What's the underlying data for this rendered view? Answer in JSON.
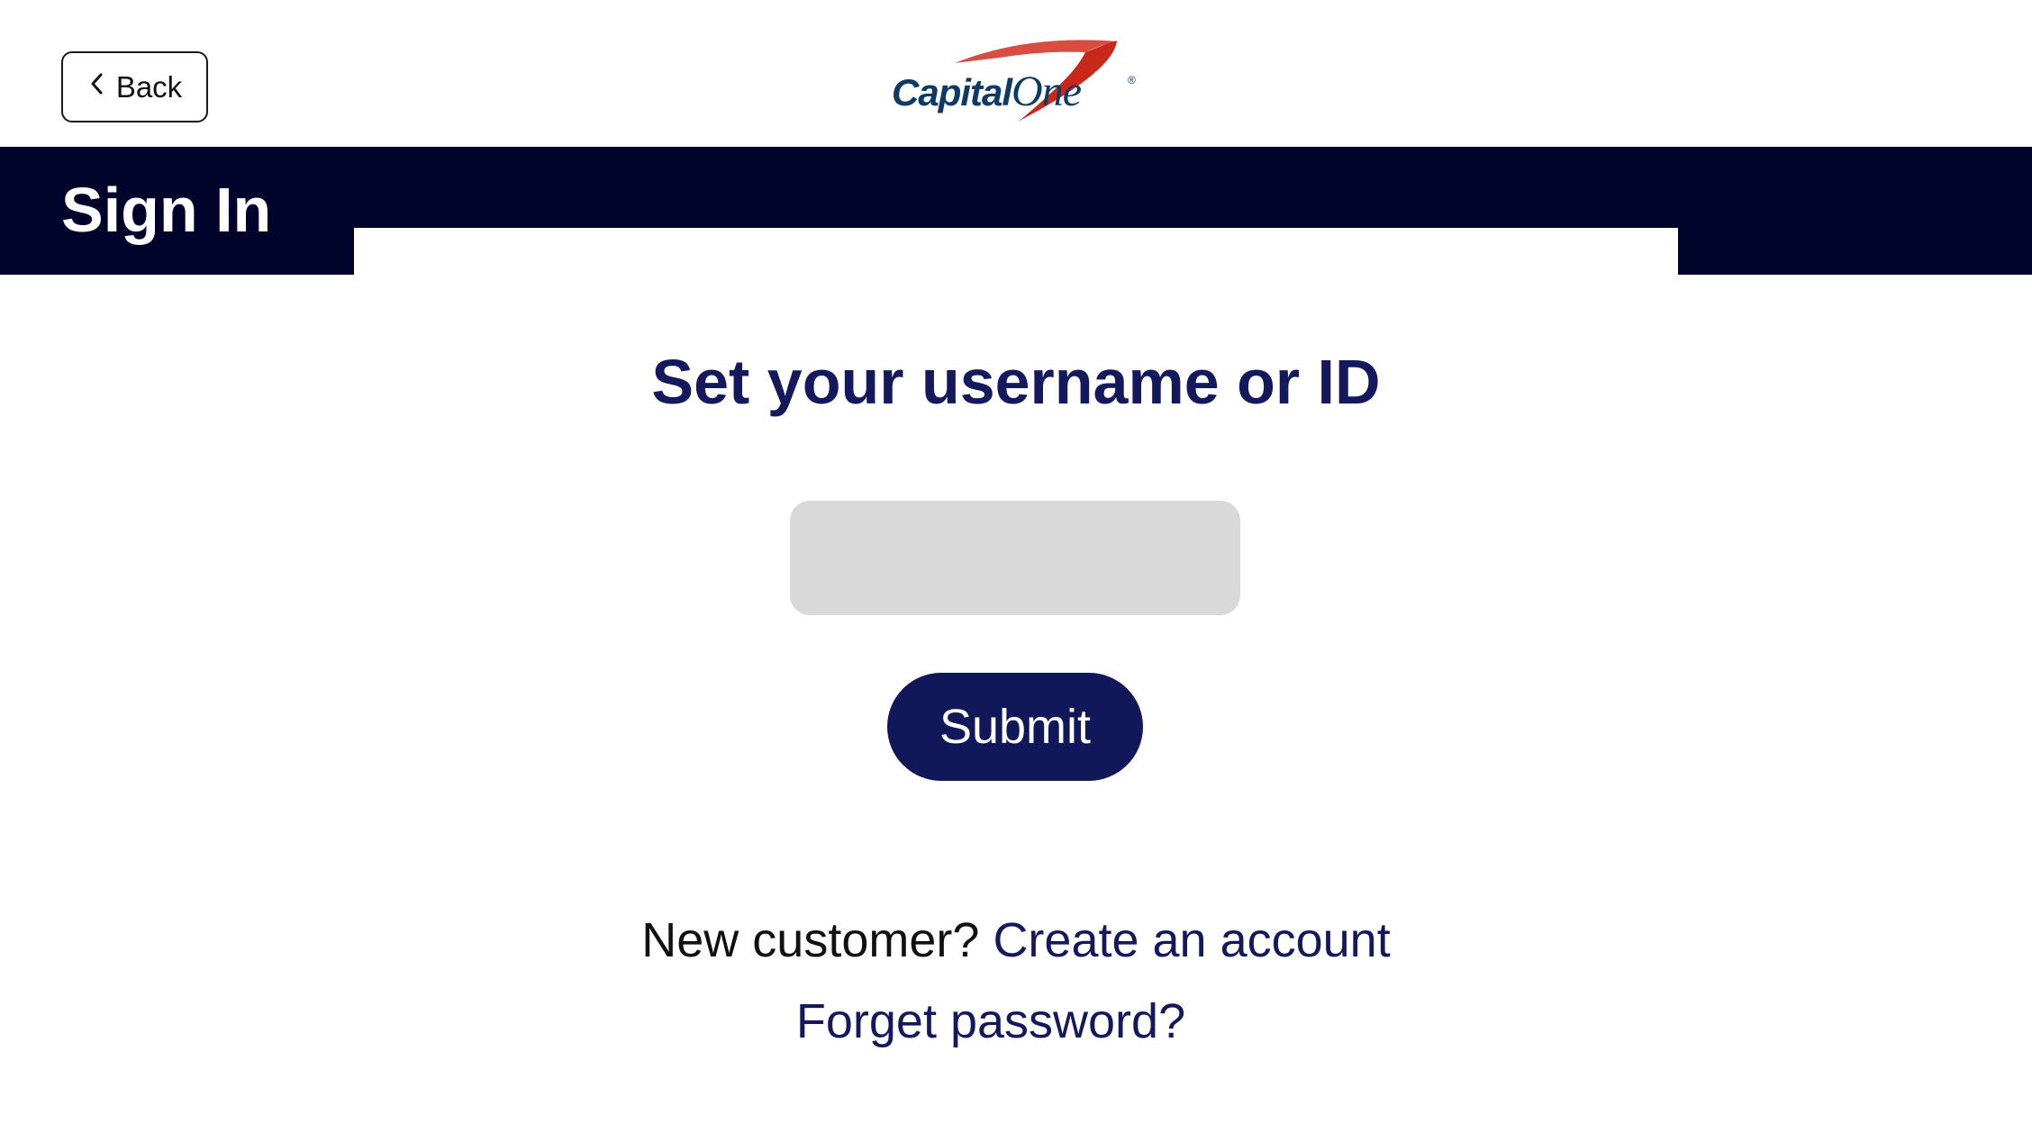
{
  "header": {
    "back_label": "Back",
    "logo_text_capital": "Capital",
    "logo_text_one": "One",
    "logo_registered": "®"
  },
  "banner": {
    "title": "Sign In"
  },
  "main": {
    "heading": "Set your username or ID",
    "username_value": "",
    "submit_label": "Submit",
    "new_customer_text": "New customer?",
    "create_account_link": "Create an account",
    "forgot_password_link": "Forget password?"
  },
  "colors": {
    "banner_background": "#00042b",
    "accent_navy": "#13195c",
    "button_background": "#11185a",
    "input_background": "#d9d9d9",
    "logo_red": "#d22e1e",
    "logo_blue": "#0d3b66"
  },
  "icons": {
    "back": "chevron-left-icon"
  }
}
